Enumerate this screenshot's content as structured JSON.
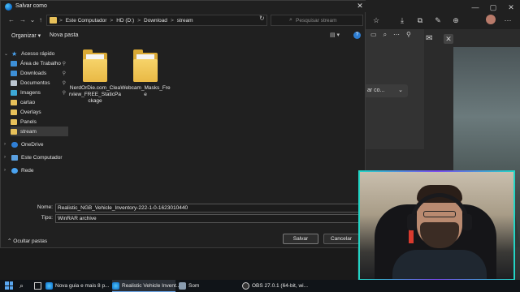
{
  "dialog": {
    "title": "Salvar como",
    "close_glyph": "✕"
  },
  "nav": {
    "back": "←",
    "forward": "→",
    "recent": "⌄",
    "up": "↑"
  },
  "address": {
    "crumbs": [
      "Este Computador",
      "HD (D:)",
      "Download",
      "stream"
    ],
    "separator": ">",
    "chevron": "⌄",
    "refresh": "↻"
  },
  "search": {
    "placeholder": "Pesquisar stream",
    "icon": "search-icon"
  },
  "commands": {
    "organize": "Organizar ▾",
    "new_folder": "Nova pasta",
    "view": "▤ ▾",
    "help": "?"
  },
  "navpane": {
    "items": [
      {
        "label": "Acesso rápido",
        "icon": "star-icon"
      },
      {
        "label": "Área de Trabalho",
        "icon": "desktop-icon",
        "pinned": true
      },
      {
        "label": "Downloads",
        "icon": "download-icon",
        "pinned": true
      },
      {
        "label": "Documentos",
        "icon": "documents-icon",
        "pinned": true
      },
      {
        "label": "Imagens",
        "icon": "images-icon",
        "pinned": true
      },
      {
        "label": "cartao",
        "icon": "folder-icon"
      },
      {
        "label": "Overlays",
        "icon": "folder-icon"
      },
      {
        "label": "Panels",
        "icon": "folder-icon"
      },
      {
        "label": "stream",
        "icon": "folder-icon",
        "selected": true
      },
      {
        "label": "OneDrive",
        "icon": "cloud-icon"
      },
      {
        "label": "Este Computador",
        "icon": "computer-icon"
      },
      {
        "label": "Rede",
        "icon": "network-icon"
      }
    ],
    "pin_glyph": "📌",
    "expand_glyph": "›",
    "collapse_glyph": "⌄"
  },
  "files": [
    {
      "label": "NerdOrDie.com_Clearview_FREE_StaticPackage"
    },
    {
      "label": "Webcam_Masks_Free"
    }
  ],
  "fields": {
    "name_label": "Nome:",
    "name_value": "Realistic_NGB_Vehicle_Inventory-222-1-0-1623010440",
    "type_label": "Tipo:",
    "type_value": "WinRAR archive"
  },
  "footer": {
    "hide_folders": "Ocultar pastas",
    "hide_glyph": "⌃",
    "save": "Salvar",
    "cancel": "Cancelar"
  },
  "background_browser": {
    "save_dropdown": "ar co...",
    "window_min": "—",
    "window_max": "▢",
    "window_close": "✕"
  },
  "taskbar": {
    "items": [
      {
        "label": "Nova guia e mais 8 p...",
        "icon": "edge-icon"
      },
      {
        "label": "Realistic Vehicle Invent...",
        "icon": "edge-icon",
        "active": true
      },
      {
        "label": "Som",
        "icon": "speaker-icon"
      },
      {
        "label": "OBS 27.0.1 (64-bit, wi...",
        "icon": "obs-icon"
      }
    ]
  },
  "colors": {
    "accent": "#2d7dd2",
    "folder": "#e8c15a",
    "webcam_border_1": "#23d5c5",
    "webcam_border_2": "#7b4bf0"
  }
}
